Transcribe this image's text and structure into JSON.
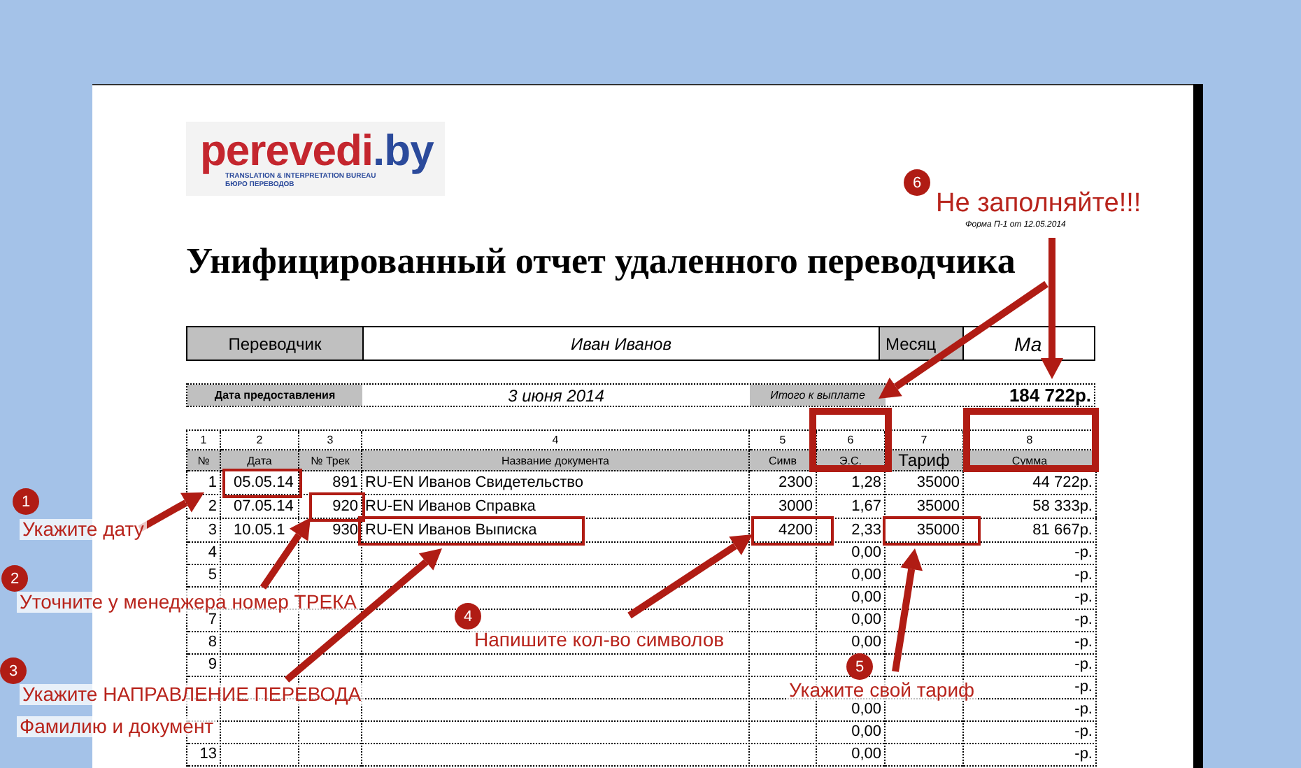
{
  "logo": {
    "name_main": "perevedi",
    "name_domain": ".by",
    "tagline": "TRANSLATION & INTERPRETATION BUREAU",
    "tagline_ru": "БЮРО ПЕРЕВОДОВ"
  },
  "form_label": "Форма П-1 от 12.05.2014",
  "title": "Унифицированный отчет удаленного переводчика",
  "translator": {
    "label": "Переводчик",
    "value": "Иван Иванов",
    "month_label": "Месяц",
    "month_value": "Ма"
  },
  "summary": {
    "date_label": "Дата предоставления",
    "date_value": "3 июня 2014",
    "total_label": "Итого к выплате",
    "total_value": "184 722р."
  },
  "table": {
    "column_numbers": [
      "1",
      "2",
      "3",
      "4",
      "5",
      "6",
      "7",
      "8"
    ],
    "columns": [
      "№",
      "Дата",
      "№ Трек",
      "Название документа",
      "Симв",
      "Э.С.",
      "Тариф",
      "Сумма"
    ],
    "rows": [
      {
        "n": "1",
        "date": "05.05.14",
        "track": "891",
        "name": "RU-EN Иванов Свидетельство",
        "chars": "2300",
        "es": "1,28",
        "tariff": "35000",
        "sum": "44 722р."
      },
      {
        "n": "2",
        "date": "07.05.14",
        "track": "920",
        "name": "RU-EN Иванов Справка",
        "chars": "3000",
        "es": "1,67",
        "tariff": "35000",
        "sum": "58 333р."
      },
      {
        "n": "3",
        "date": "10.05.1",
        "track": "930",
        "name": "RU-EN Иванов Выписка",
        "chars": "4200",
        "es": "2,33",
        "tariff": "35000",
        "sum": "81 667р."
      },
      {
        "n": "4",
        "es": "0,00",
        "sum": "-р."
      },
      {
        "n": "5",
        "es": "0,00",
        "sum": "-р."
      },
      {
        "es": "0,00",
        "sum": "-р."
      },
      {
        "n": "7",
        "es": "0,00",
        "sum": "-р."
      },
      {
        "n": "8",
        "es": "0,00",
        "sum": "-р."
      },
      {
        "n": "9",
        "sum": "-р."
      },
      {
        "sum": "-р."
      },
      {
        "es": "0,00",
        "sum": "-р."
      },
      {
        "es": "0,00",
        "sum": "-р."
      },
      {
        "n": "13",
        "es": "0,00",
        "sum": "-р."
      }
    ]
  },
  "annotations": [
    {
      "badge": "1",
      "lines": [
        "Укажите дату"
      ]
    },
    {
      "badge": "2",
      "lines": [
        "Уточните у менеджера номер ТРЕКА"
      ]
    },
    {
      "badge": "3",
      "lines": [
        "Укажите НАПРАВЛЕНИЕ ПЕРЕВОДА",
        "Фамилию и документ"
      ]
    },
    {
      "badge": "4",
      "lines": [
        "Напишите кол-во символов"
      ]
    },
    {
      "badge": "5",
      "lines": [
        "Укажите свой тариф"
      ]
    },
    {
      "badge": "6",
      "lines": [
        "Не заполняйте!!!"
      ]
    }
  ]
}
